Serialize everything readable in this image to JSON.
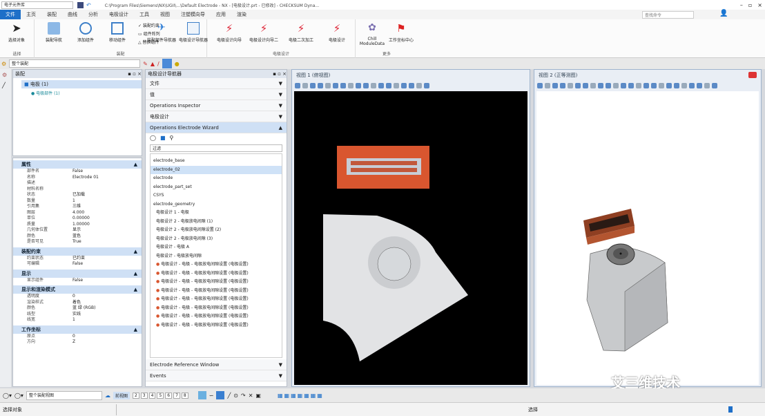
{
  "titlebar": {
    "part_dropdown": "电子元件库",
    "title": "C:\\Program Files\\Siemens\\NX\\UGII\\...\\Default Electrode - NX - [电极设计.prt - 已修改] - CHECKSUM Dyna...",
    "search_placeholder": "查找命令"
  },
  "tabs": [
    "文件",
    "主页",
    "装配",
    "曲线",
    "分析",
    "电极设计",
    "工具",
    "视图",
    "注塑模向导",
    "应用",
    "渲染"
  ],
  "ribbon": {
    "groups": [
      {
        "label": "选择",
        "buttons": [
          "选择对象"
        ]
      },
      {
        "label": "装配",
        "buttons": [
          "装配导航",
          "添加组件",
          "移动组件"
        ],
        "small": [
          "装配约束",
          "组件阵列",
          "替换组件"
        ]
      },
      {
        "label": "",
        "buttons": [
          "装配部件导航器",
          "电极设计导航器"
        ]
      },
      {
        "label": "电极设计",
        "buttons": [
          "电极设计向导",
          "电极设计向导二",
          "电极二次加工",
          "电极设计"
        ]
      },
      {
        "label": "更多",
        "buttons": [
          "Chill ModuleData",
          "工作坐标中心"
        ]
      }
    ]
  },
  "toolbar2": {
    "filter": "整个装配"
  },
  "assembly_nav": {
    "title": "装配",
    "items": [
      "电极 (1)",
      "电极部件 (1)"
    ]
  },
  "properties": {
    "sections": [
      {
        "title": "属性",
        "rows": [
          [
            "部件名",
            "False"
          ],
          [
            "名称",
            "Electrode 01"
          ],
          [
            "描述",
            ""
          ],
          [
            "材料名称",
            ""
          ],
          [
            "状态",
            "已加载"
          ],
          [
            "数量",
            "1"
          ],
          [
            "引用集",
            "三维"
          ],
          [
            "图层",
            "4.000"
          ],
          [
            "单位",
            "0.00000"
          ],
          [
            "质量",
            "1.00000"
          ],
          [
            "几何体位置",
            "显示"
          ],
          [
            "颜色",
            "蓝色"
          ],
          [
            "是否可见",
            "True"
          ]
        ]
      },
      {
        "title": "装配约束",
        "rows": [
          [
            "约束状态",
            "已约束"
          ],
          [
            "可编辑",
            "False"
          ]
        ]
      },
      {
        "title": "显示",
        "rows": [
          [
            "显示组件",
            "False"
          ]
        ]
      },
      {
        "title": "显示和渲染模式",
        "rows": [
          [
            "透明度",
            "0"
          ],
          [
            "渲染样式",
            "着色"
          ],
          [
            "颜色",
            "蓝 绿 (RGB)"
          ],
          [
            "线型",
            "实线"
          ],
          [
            "线宽",
            "1"
          ]
        ]
      },
      {
        "title": "工作坐标",
        "rows": [
          [
            "原点",
            "0"
          ],
          [
            "方向",
            "Z"
          ]
        ]
      }
    ]
  },
  "mid_panel": {
    "title": "电极设计导航器",
    "rows": [
      "文件",
      "值",
      "Operations Inspector",
      "电极设计",
      "Operations Electrode Wizard"
    ],
    "filter_value": "过滤",
    "list": [
      "electrode_base",
      "electrode_02",
      "electrode",
      "electrode_part_set",
      "CSYS",
      "electrode_geometry",
      "电极设计 1 - 电极",
      "电极设计 2 - 电极放电间隙 (1)",
      "电极设计 2 - 电极放电间隙设置 (2)",
      "电极设计 2 - 电极放电间隙 (3)",
      "电极设计 - 电极 A",
      "电极设计 - 电极放电间隙",
      "电极设计 - 电极 - 电极放电间隙设置 (电极设置)",
      "电极设计 - 电极 - 电极放电间隙设置 (电极设置)",
      "电极设计 - 电极 - 电极放电间隙设置 (电极设置)",
      "电极设计 - 电极 - 电极放电间隙设置 (电极设置)",
      "电极设计 - 电极 - 电极放电间隙设置 (电极设置)",
      "电极设计 - 电极 - 电极放电间隙设置 (电极设置)",
      "电极设计 - 电极 - 电极放电间隙设置 (电极设置)",
      "电极设计 - 电极 - 电极放电间隙设置 (电极设置)"
    ],
    "footer": [
      "Electrode Reference Window",
      "Events"
    ]
  },
  "viewport1": {
    "title": "视图 1 (俯视图)"
  },
  "viewport2": {
    "title": "视图 2 (正等测图)"
  },
  "bottombar": {
    "view_dropdown": "整个装配视图",
    "layers": [
      "2",
      "3",
      "4",
      "5",
      "6",
      "7",
      "8"
    ],
    "active_layer": "前视图"
  },
  "status": {
    "left": "选择对象",
    "right": "选择"
  },
  "watermark": "艾三维技术",
  "colors": {
    "accent": "#1e6fc8",
    "viewport1_bg": "#000000",
    "electrode": "#d9562f",
    "cyan": "#33f0f5"
  }
}
